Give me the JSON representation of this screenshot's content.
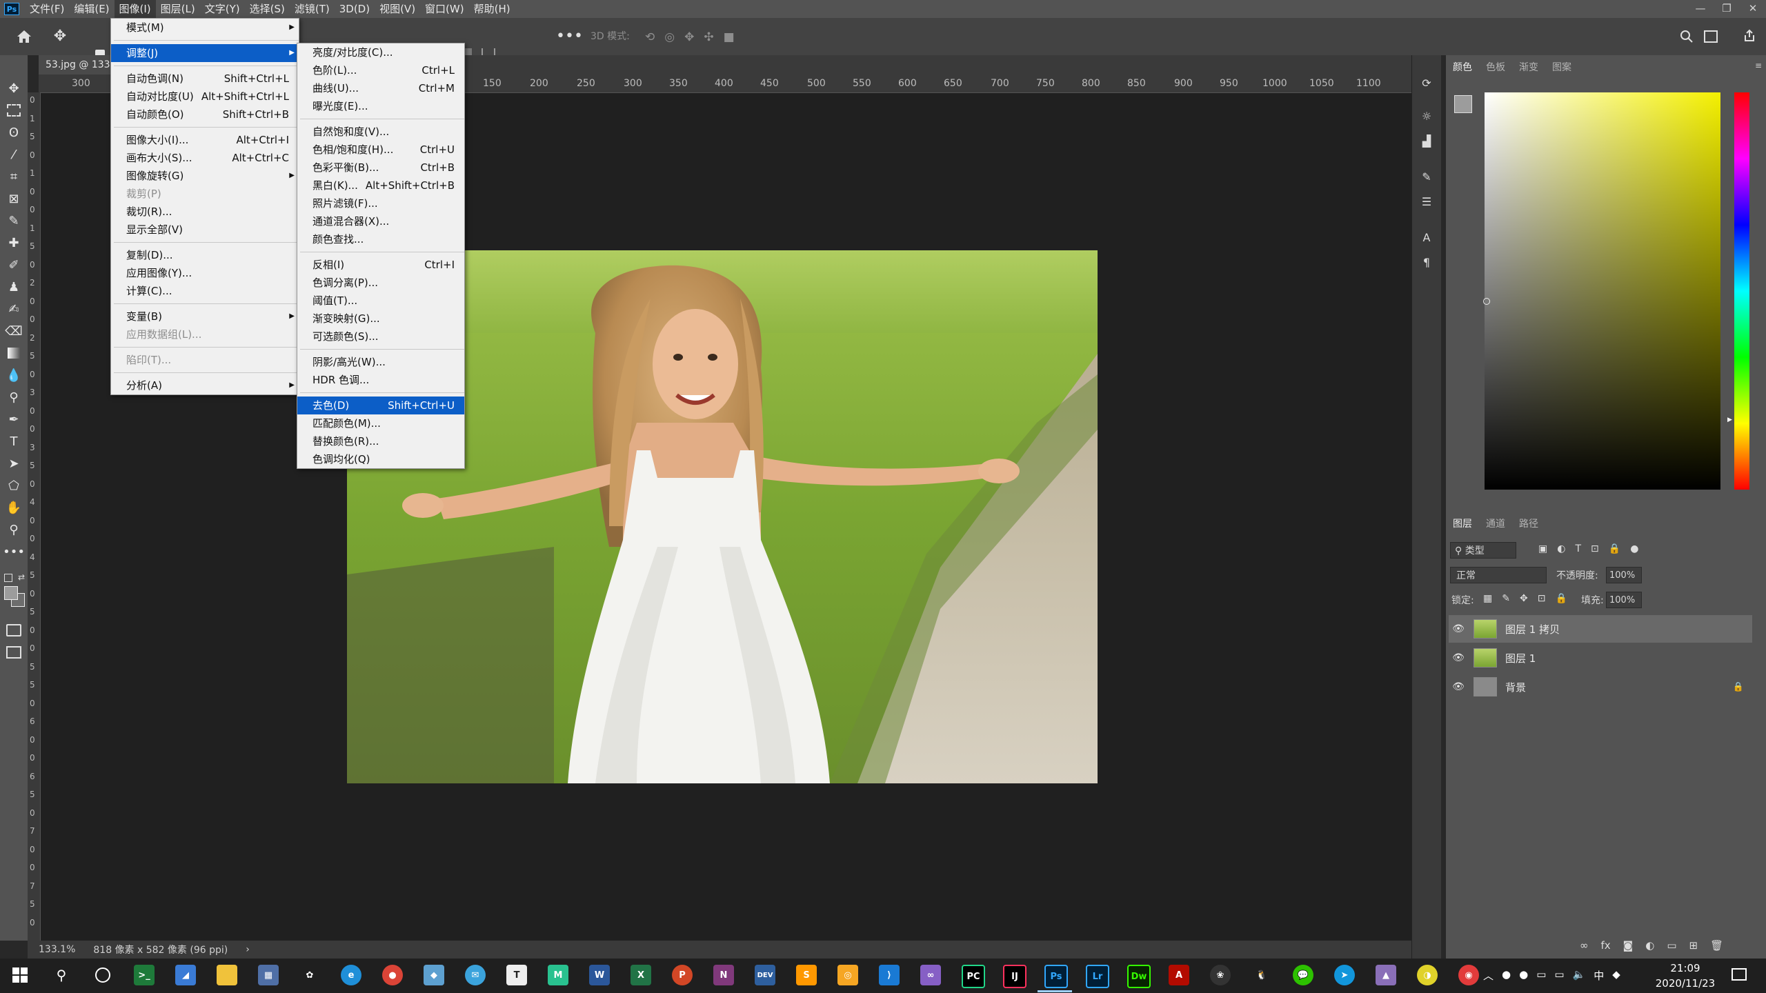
{
  "app": {
    "logo": "Ps"
  },
  "menubar": {
    "items": [
      "文件(F)",
      "编辑(E)",
      "图像(I)",
      "图层(L)",
      "文字(Y)",
      "选择(S)",
      "滤镜(T)",
      "3D(D)",
      "视图(V)",
      "窗口(W)",
      "帮助(H)"
    ],
    "active_index": 2
  },
  "window_controls": {
    "minimize": "—",
    "restore": "❐",
    "close": "✕"
  },
  "options_bar": {
    "mode_label": "3D 模式:"
  },
  "document": {
    "tab_label": "53.jpg @ 133%"
  },
  "ruler": {
    "h_ticks": [
      "300",
      "150",
      "200",
      "250",
      "300",
      "350",
      "400",
      "450",
      "500",
      "550",
      "600",
      "650",
      "700",
      "750",
      "800",
      "850",
      "900",
      "950",
      "1000",
      "1050",
      "1100"
    ],
    "v_digits": [
      "0",
      "1",
      "5",
      "0",
      "1",
      "0",
      "0",
      "1",
      "5",
      "0",
      "2",
      "0",
      "0",
      "2",
      "5",
      "0",
      "3",
      "0",
      "0",
      "3",
      "5",
      "0",
      "4",
      "0",
      "0",
      "4",
      "5",
      "0",
      "5",
      "0",
      "0",
      "5",
      "5",
      "0",
      "6",
      "0",
      "0",
      "6",
      "5",
      "0",
      "7",
      "0",
      "0",
      "7",
      "5",
      "0"
    ]
  },
  "image_menu": {
    "items": [
      {
        "label": "模式(M)",
        "shortcut": "",
        "submenu": true
      },
      {
        "sep": true
      },
      {
        "label": "调整(J)",
        "shortcut": "",
        "submenu": true,
        "highlight": true
      },
      {
        "sep": true
      },
      {
        "label": "自动色调(N)",
        "shortcut": "Shift+Ctrl+L"
      },
      {
        "label": "自动对比度(U)",
        "shortcut": "Alt+Shift+Ctrl+L"
      },
      {
        "label": "自动颜色(O)",
        "shortcut": "Shift+Ctrl+B"
      },
      {
        "sep": true
      },
      {
        "label": "图像大小(I)...",
        "shortcut": "Alt+Ctrl+I"
      },
      {
        "label": "画布大小(S)...",
        "shortcut": "Alt+Ctrl+C"
      },
      {
        "label": "图像旋转(G)",
        "shortcut": "",
        "submenu": true
      },
      {
        "label": "裁剪(P)",
        "shortcut": "",
        "disabled": true
      },
      {
        "label": "裁切(R)...",
        "shortcut": ""
      },
      {
        "label": "显示全部(V)",
        "shortcut": ""
      },
      {
        "sep": true
      },
      {
        "label": "复制(D)...",
        "shortcut": ""
      },
      {
        "label": "应用图像(Y)...",
        "shortcut": ""
      },
      {
        "label": "计算(C)...",
        "shortcut": ""
      },
      {
        "sep": true
      },
      {
        "label": "变量(B)",
        "shortcut": "",
        "submenu": true
      },
      {
        "label": "应用数据组(L)...",
        "shortcut": "",
        "disabled": true
      },
      {
        "sep": true
      },
      {
        "label": "陷印(T)...",
        "shortcut": "",
        "disabled": true
      },
      {
        "sep": true
      },
      {
        "label": "分析(A)",
        "shortcut": "",
        "submenu": true
      }
    ]
  },
  "adjust_menu": {
    "items": [
      {
        "label": "亮度/对比度(C)...",
        "shortcut": ""
      },
      {
        "label": "色阶(L)...",
        "shortcut": "Ctrl+L"
      },
      {
        "label": "曲线(U)...",
        "shortcut": "Ctrl+M"
      },
      {
        "label": "曝光度(E)...",
        "shortcut": ""
      },
      {
        "sep": true
      },
      {
        "label": "自然饱和度(V)...",
        "shortcut": ""
      },
      {
        "label": "色相/饱和度(H)...",
        "shortcut": "Ctrl+U"
      },
      {
        "label": "色彩平衡(B)...",
        "shortcut": "Ctrl+B"
      },
      {
        "label": "黑白(K)...",
        "shortcut": "Alt+Shift+Ctrl+B"
      },
      {
        "label": "照片滤镜(F)...",
        "shortcut": ""
      },
      {
        "label": "通道混合器(X)...",
        "shortcut": ""
      },
      {
        "label": "颜色查找...",
        "shortcut": ""
      },
      {
        "sep": true
      },
      {
        "label": "反相(I)",
        "shortcut": "Ctrl+I"
      },
      {
        "label": "色调分离(P)...",
        "shortcut": ""
      },
      {
        "label": "阈值(T)...",
        "shortcut": ""
      },
      {
        "label": "渐变映射(G)...",
        "shortcut": ""
      },
      {
        "label": "可选颜色(S)...",
        "shortcut": ""
      },
      {
        "sep": true
      },
      {
        "label": "阴影/高光(W)...",
        "shortcut": ""
      },
      {
        "label": "HDR 色调...",
        "shortcut": ""
      },
      {
        "sep": true
      },
      {
        "label": "去色(D)",
        "shortcut": "Shift+Ctrl+U",
        "highlight": true
      },
      {
        "label": "匹配颜色(M)...",
        "shortcut": ""
      },
      {
        "label": "替换颜色(R)...",
        "shortcut": ""
      },
      {
        "label": "色调均化(Q)",
        "shortcut": ""
      }
    ]
  },
  "color_panel": {
    "tabs": [
      "颜色",
      "色板",
      "渐变",
      "图案"
    ],
    "active": 0,
    "hue_color": "#f4f000"
  },
  "layers_panel": {
    "tabs": [
      "图层",
      "通道",
      "路径"
    ],
    "active": 0,
    "filter_label": "类型",
    "blend_mode": "正常",
    "opacity_label": "不透明度:",
    "opacity_value": "100%",
    "lock_label": "锁定:",
    "fill_label": "填充:",
    "fill_value": "100%",
    "layers": [
      {
        "name": "图层 1 拷贝",
        "selected": true,
        "locked": false
      },
      {
        "name": "图层 1",
        "selected": false,
        "locked": false
      },
      {
        "name": "背景",
        "selected": false,
        "locked": true
      }
    ]
  },
  "status": {
    "zoom": "133.1%",
    "info": "818 像素 x 582 像素 (96 ppi)",
    "arrow": "›"
  },
  "taskbar": {
    "apps": [
      "Ps",
      "Lr",
      "Dw",
      "W",
      "X",
      "P",
      "N",
      "PC",
      "IJ"
    ],
    "tray_ime": "中",
    "time": "21:09",
    "date": "2020/11/23"
  }
}
